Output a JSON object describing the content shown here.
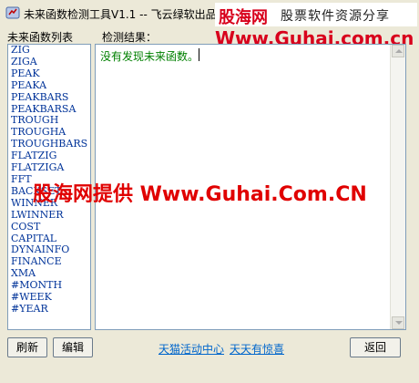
{
  "window": {
    "title": "未来函数检测工具V1.1 -- 飞云绿软出品"
  },
  "brand": {
    "logo": "股海网",
    "slogan": "股票软件资源分享",
    "url": "Www.Guhai.com.cn"
  },
  "function_list": {
    "label": "未来函数列表",
    "items": [
      "ZIG",
      "ZIGA",
      "PEAK",
      "PEAKA",
      "PEAKBARS",
      "PEAKBARSA",
      "TROUGH",
      "TROUGHA",
      "TROUGHBARS",
      "FLATZIG",
      "FLATZIGA",
      "FFT",
      "BACKSET",
      "WINNER",
      "LWINNER",
      "COST",
      "CAPITAL",
      "DYNAINFO",
      "FINANCE",
      "XMA",
      "#MONTH",
      "#WEEK",
      "#YEAR"
    ]
  },
  "result": {
    "label": "检测结果：",
    "text": "没有发现未来函数。"
  },
  "watermark": "股海网提供 Www.Guhai.Com.CN",
  "buttons": {
    "refresh": "刷新",
    "edit": "编辑",
    "back": "返回"
  },
  "links": {
    "link1": "天猫活动中心",
    "link2": "天天有惊喜"
  },
  "colors": {
    "background": "#ece9d8",
    "list_text": "#003399",
    "result_text": "#008000",
    "watermark": "#e00000",
    "link": "#0066cc"
  }
}
